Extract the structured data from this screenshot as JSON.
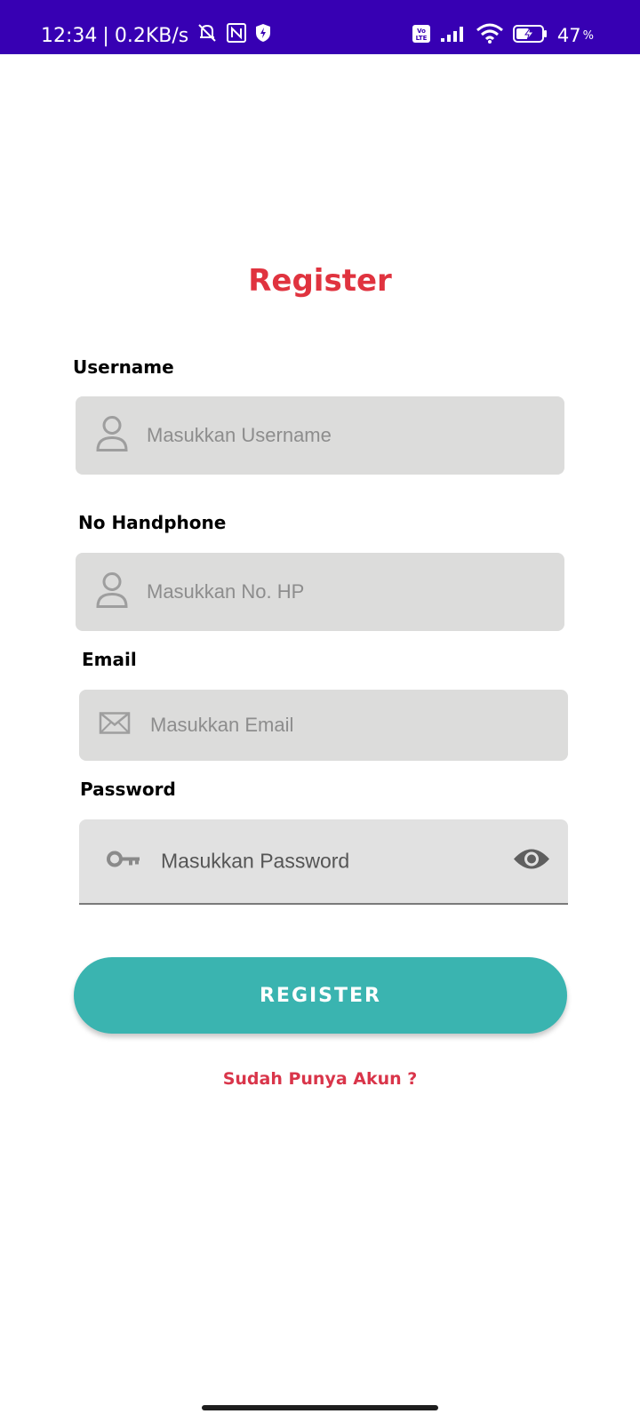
{
  "status_bar": {
    "time": "12:34",
    "separator": "|",
    "speed": "0.2KB/s",
    "battery": "47",
    "battery_unit": "%"
  },
  "page": {
    "title": "Register"
  },
  "form": {
    "username": {
      "label": "Username",
      "placeholder": "Masukkan Username",
      "icon": "person-icon"
    },
    "phone": {
      "label": "No Handphone",
      "placeholder": "Masukkan No. HP",
      "icon": "person-icon"
    },
    "email": {
      "label": "Email",
      "placeholder": "Masukkan Email",
      "icon": "mail-icon"
    },
    "password": {
      "label": "Password",
      "placeholder": "Masukkan Password",
      "icon": "key-icon",
      "toggle_icon": "eye-icon"
    }
  },
  "actions": {
    "register_label": "REGISTER",
    "login_link": "Sudah Punya Akun ?"
  },
  "colors": {
    "status_bar": "#3700b3",
    "title": "#e0333f",
    "button": "#3ab4b0",
    "link": "#d9354a",
    "field_bg": "#dcdcdb"
  }
}
